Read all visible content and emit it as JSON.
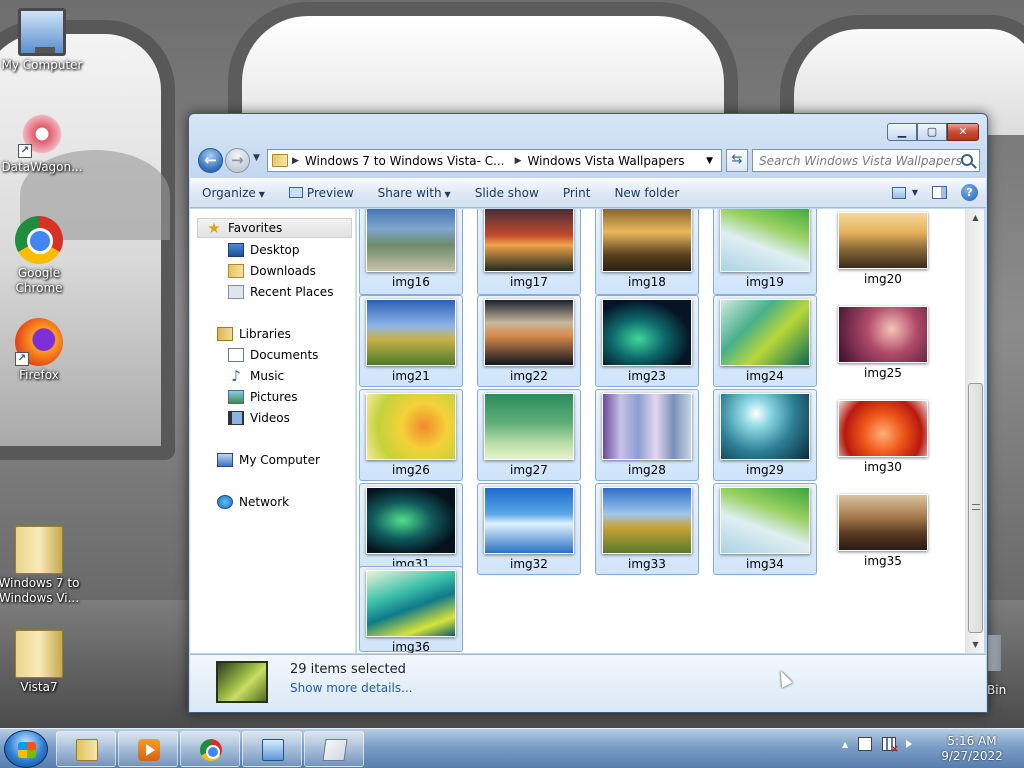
{
  "desktop": {
    "icons": [
      {
        "label": "My Computer"
      },
      {
        "label": "DataWagon..."
      },
      {
        "label": "Google Chrome"
      },
      {
        "label": "Firefox"
      },
      {
        "label": "Windows 7 to Windows Vi..."
      },
      {
        "label": "Vista7"
      }
    ],
    "recycle_fragment": "Bin"
  },
  "window": {
    "caption_buttons": {
      "minimize": "▁",
      "maximize": "▢",
      "close": "✕"
    },
    "address": {
      "crumbs": [
        "Windows 7 to Windows Vista- C...",
        "Windows Vista Wallpapers"
      ]
    },
    "search_placeholder": "Search Windows Vista Wallpapers",
    "toolbar": {
      "organize": "Organize",
      "preview": "Preview",
      "share_with": "Share with",
      "slide_show": "Slide show",
      "print": "Print",
      "new_folder": "New folder"
    },
    "nav": {
      "favorites": "Favorites",
      "desktop": "Desktop",
      "downloads": "Downloads",
      "recent_places": "Recent Places",
      "libraries": "Libraries",
      "documents": "Documents",
      "music": "Music",
      "pictures": "Pictures",
      "videos": "Videos",
      "my_computer": "My Computer",
      "network": "Network"
    },
    "files": [
      {
        "name": "img16",
        "selected": true
      },
      {
        "name": "img17",
        "selected": true
      },
      {
        "name": "img18",
        "selected": true
      },
      {
        "name": "img19",
        "selected": true
      },
      {
        "name": "img20",
        "selected": false
      },
      {
        "name": "img21",
        "selected": true
      },
      {
        "name": "img22",
        "selected": true
      },
      {
        "name": "img23",
        "selected": true
      },
      {
        "name": "img24",
        "selected": true
      },
      {
        "name": "img25",
        "selected": false
      },
      {
        "name": "img26",
        "selected": true
      },
      {
        "name": "img27",
        "selected": true
      },
      {
        "name": "img28",
        "selected": true
      },
      {
        "name": "img29",
        "selected": true
      },
      {
        "name": "img30",
        "selected": false
      },
      {
        "name": "img31",
        "selected": true
      },
      {
        "name": "img32",
        "selected": true
      },
      {
        "name": "img33",
        "selected": true
      },
      {
        "name": "img34",
        "selected": true
      },
      {
        "name": "img35",
        "selected": false
      },
      {
        "name": "img36",
        "selected": true
      }
    ],
    "details": {
      "title": "29 items selected",
      "link": "Show more details..."
    }
  },
  "taskbar": {
    "clock_time": "5:16 AM",
    "clock_date": "9/27/2022"
  }
}
